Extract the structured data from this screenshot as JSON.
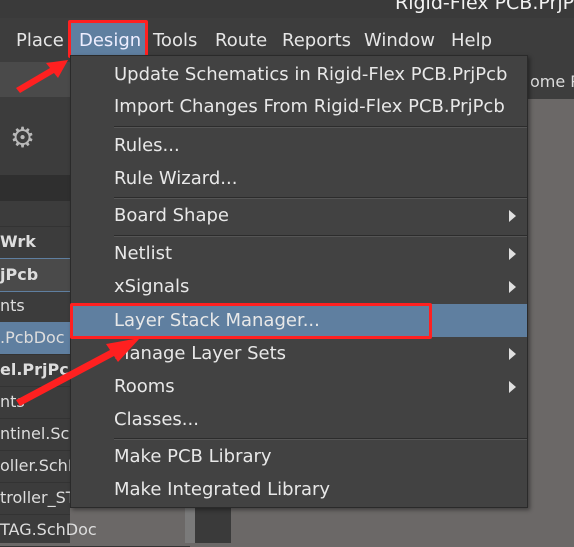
{
  "window": {
    "title": "Rigid-Flex PCB.PrjPcb"
  },
  "menubar": {
    "items": [
      "Place",
      "Design",
      "Tools",
      "Route",
      "Reports",
      "Window",
      "Help"
    ],
    "active": "Design"
  },
  "left_panel": {
    "rows": [
      "Wrk",
      "jPcb",
      "nts",
      ".PcbDoc",
      "el.PrjPcb",
      "nts",
      "ntinel.Sch",
      "oller.SchD",
      "troller_ST",
      "TAG.SchDoc"
    ],
    "icon": "gear-icon"
  },
  "right_panel": {
    "tab": "ome Pa"
  },
  "design_menu": {
    "items": [
      {
        "label": "Update Schematics in Rigid-Flex PCB.PrjPcb",
        "submenu": false
      },
      {
        "label": "Import Changes From Rigid-Flex PCB.PrjPcb",
        "submenu": false
      },
      {
        "label": "Rules...",
        "submenu": false
      },
      {
        "label": "Rule Wizard...",
        "submenu": false
      },
      {
        "label": "Board Shape",
        "submenu": true
      },
      {
        "label": "Netlist",
        "submenu": true
      },
      {
        "label": "xSignals",
        "submenu": true
      },
      {
        "label": "Layer Stack Manager...",
        "submenu": false,
        "highlighted": true
      },
      {
        "label": "Manage Layer Sets",
        "submenu": true
      },
      {
        "label": "Rooms",
        "submenu": true
      },
      {
        "label": "Classes...",
        "submenu": false
      },
      {
        "label": "Make PCB Library",
        "submenu": false
      },
      {
        "label": "Make Integrated Library",
        "submenu": false
      }
    ]
  },
  "colors": {
    "highlight": "#5f7fa0",
    "annotation": "#ff2020",
    "menu_bg": "#424242"
  }
}
